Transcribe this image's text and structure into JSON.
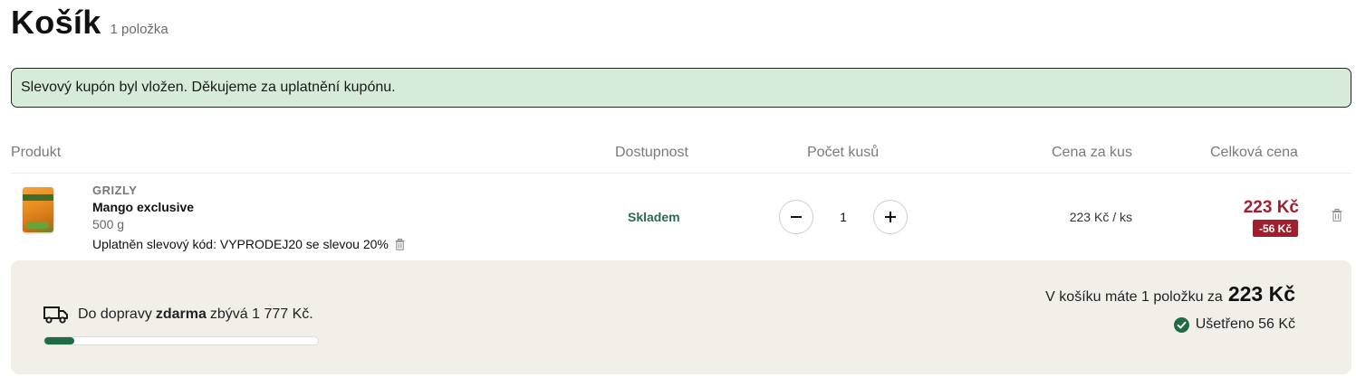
{
  "header": {
    "title": "Košík",
    "item_count": "1 položka"
  },
  "alert": {
    "message": "Slevový kupón byl vložen. Děkujeme za uplatnění kupónu."
  },
  "table": {
    "columns": {
      "product": "Produkt",
      "availability": "Dostupnost",
      "quantity": "Počet kusů",
      "unit_price": "Cena za kus",
      "total_price": "Celková cena"
    }
  },
  "item": {
    "brand": "GRIZLY",
    "name": "Mango exclusive",
    "weight": "500 g",
    "coupon_note": "Uplatněn slevový kód: VYPRODEJ20 se slevou 20%",
    "availability": "Skladem",
    "quantity": "1",
    "unit_price": "223 Kč / ks",
    "total_price": "223 Kč",
    "discount": "-56  Kč"
  },
  "summary": {
    "shipping_prefix": "Do dopravy",
    "shipping_bold": "zdarma",
    "shipping_suffix": "zbývá 1 777 Kč.",
    "shipping_progress": 0.11,
    "cart_text": "V košíku máte 1 položku za",
    "cart_total": "223 Kč",
    "saved_text": "Ušetřeno 56  Kč"
  },
  "colors": {
    "accent_green": "#1f6b43",
    "price_red": "#a11e2e",
    "alert_bg": "#d6ecd9",
    "summary_bg": "#f2efe9"
  },
  "icons": {
    "minus": "minus-icon",
    "plus": "plus-icon",
    "trash": "trash-icon",
    "truck": "truck-icon",
    "check": "check-circle-icon"
  }
}
